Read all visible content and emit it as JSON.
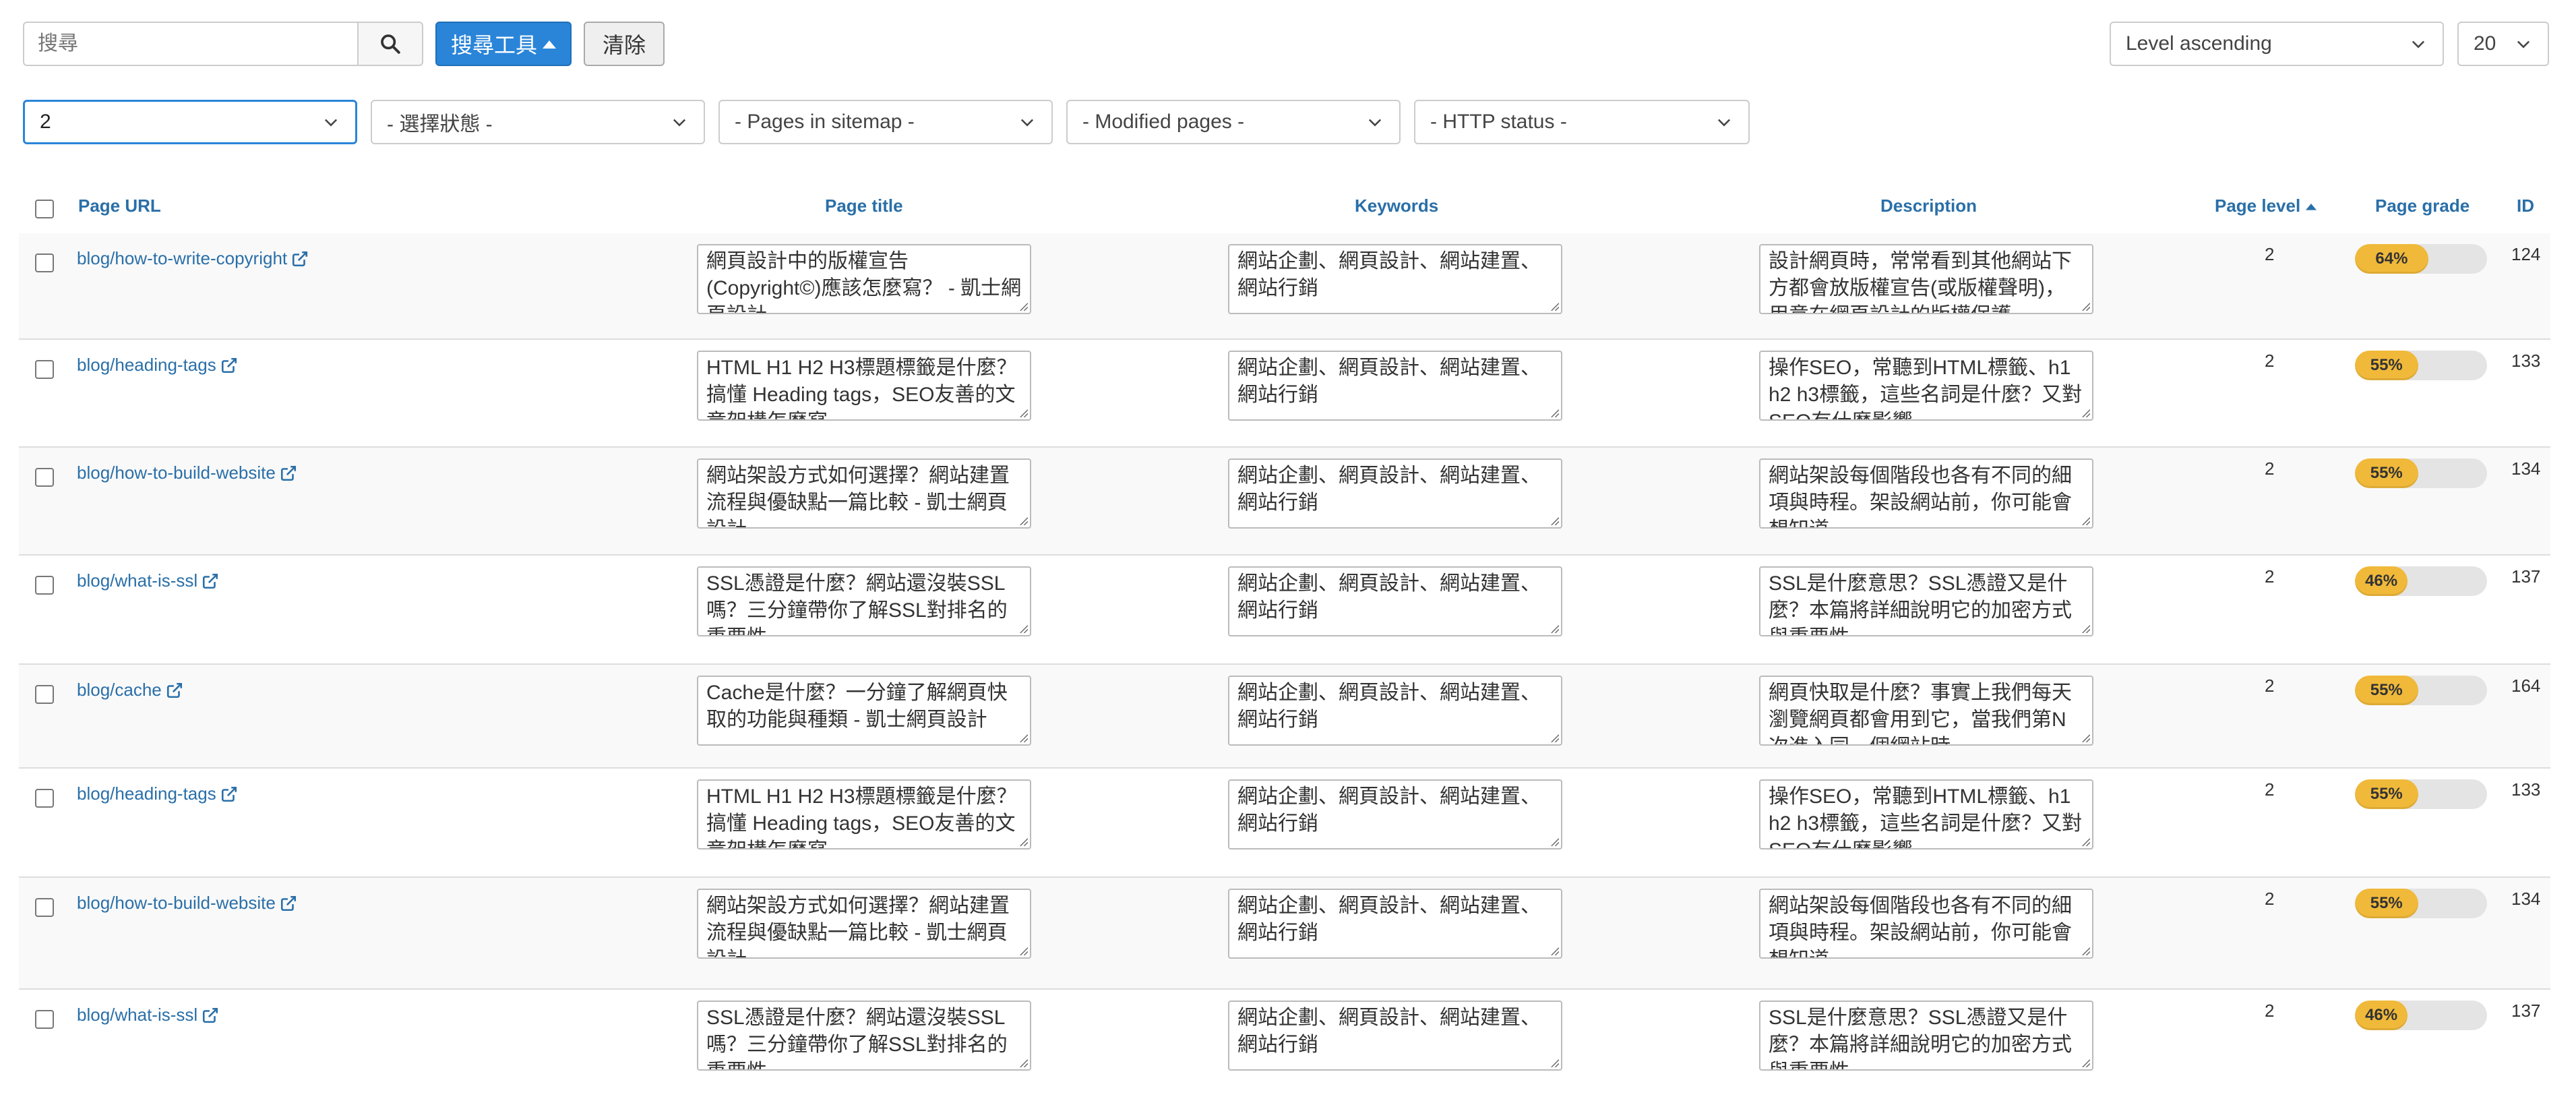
{
  "toolbar": {
    "search_placeholder": "搜尋",
    "search_tools_label": "搜尋工具",
    "clear_label": "清除",
    "sort_select": "Level ascending",
    "per_page_select": "20"
  },
  "filters": {
    "level": "2",
    "status": "- 選擇狀態 -",
    "sitemap": "- Pages in sitemap -",
    "modified": "- Modified pages -",
    "http_status": "- HTTP status -"
  },
  "table": {
    "headers": {
      "url": "Page URL",
      "title": "Page title",
      "keywords": "Keywords",
      "description": "Description",
      "level": "Page level",
      "grade": "Page grade",
      "id": "ID"
    },
    "rows": [
      {
        "url": "blog/how-to-write-copyright",
        "title": "網頁設計中的版權宣告(Copyright©)應該怎麼寫？ - 凱士網頁設計",
        "keywords": "網站企劃、網頁設計、網站建置、網站行銷",
        "description": "設計網頁時，常常看到其他網站下方都會放版權宣告(或版權聲明)，用意在網頁設計的版權保護",
        "level": "2",
        "grade": "64%",
        "grade_value": 64,
        "id": "124"
      },
      {
        "url": "blog/heading-tags",
        "title": "HTML H1 H2 H3標題標籤是什麼？搞懂 Heading tags，SEO友善的文章架構怎麼寫",
        "keywords": "網站企劃、網頁設計、網站建置、網站行銷",
        "description": "操作SEO，常聽到HTML標籤、h1 h2 h3標籤，這些名詞是什麼？又對SEO有什麼影響",
        "level": "2",
        "grade": "55%",
        "grade_value": 55,
        "id": "133"
      },
      {
        "url": "blog/how-to-build-website",
        "title": "網站架設方式如何選擇？網站建置流程與優缺點一篇比較 - 凱士網頁設計",
        "keywords": "網站企劃、網頁設計、網站建置、網站行銷",
        "description": "網站架設每個階段也各有不同的細項與時程。架設網站前，你可能會想知道",
        "level": "2",
        "grade": "55%",
        "grade_value": 55,
        "id": "134"
      },
      {
        "url": "blog/what-is-ssl",
        "title": "SSL憑證是什麼？網站還沒裝SSL嗎？三分鐘帶你了解SSL對排名的重要性",
        "keywords": "網站企劃、網頁設計、網站建置、網站行銷",
        "description": "SSL是什麼意思？SSL憑證又是什麼？本篇將詳細說明它的加密方式與重要性",
        "level": "2",
        "grade": "46%",
        "grade_value": 46,
        "id": "137"
      },
      {
        "url": "blog/cache",
        "title": "Cache是什麼？一分鐘了解網頁快取的功能與種類 - 凱士網頁設計",
        "keywords": "網站企劃、網頁設計、網站建置、網站行銷",
        "description": "網頁快取是什麼？事實上我們每天瀏覽網頁都會用到它，當我們第N次進入同一個網站時",
        "level": "2",
        "grade": "55%",
        "grade_value": 55,
        "id": "164"
      },
      {
        "url": "blog/heading-tags",
        "title": "HTML H1 H2 H3標題標籤是什麼？搞懂 Heading tags，SEO友善的文章架構怎麼寫",
        "keywords": "網站企劃、網頁設計、網站建置、網站行銷",
        "description": "操作SEO，常聽到HTML標籤、h1 h2 h3標籤，這些名詞是什麼？又對SEO有什麼影響",
        "level": "2",
        "grade": "55%",
        "grade_value": 55,
        "id": "133"
      },
      {
        "url": "blog/how-to-build-website",
        "title": "網站架設方式如何選擇？網站建置流程與優缺點一篇比較 - 凱士網頁設計",
        "keywords": "網站企劃、網頁設計、網站建置、網站行銷",
        "description": "網站架設每個階段也各有不同的細項與時程。架設網站前，你可能會想知道",
        "level": "2",
        "grade": "55%",
        "grade_value": 55,
        "id": "134"
      },
      {
        "url": "blog/what-is-ssl",
        "title": "SSL憑證是什麼？網站還沒裝SSL嗎？三分鐘帶你了解SSL對排名的重要性",
        "keywords": "網站企劃、網頁設計、網站建置、網站行銷",
        "description": "SSL是什麼意思？SSL憑證又是什麼？本篇將詳細說明它的加密方式與重要性",
        "level": "2",
        "grade": "46%",
        "grade_value": 46,
        "id": "137"
      }
    ]
  },
  "icons": {
    "search": "search-icon",
    "caret_up": "caret-up-icon",
    "chevron": "chevron-down-icon",
    "external_link": "external-link-icon",
    "sort": "sort-asc-icon"
  },
  "colors": {
    "primary": "#2a85d8",
    "link": "#2a6fa8",
    "grade_bar": "#f0b93a"
  }
}
